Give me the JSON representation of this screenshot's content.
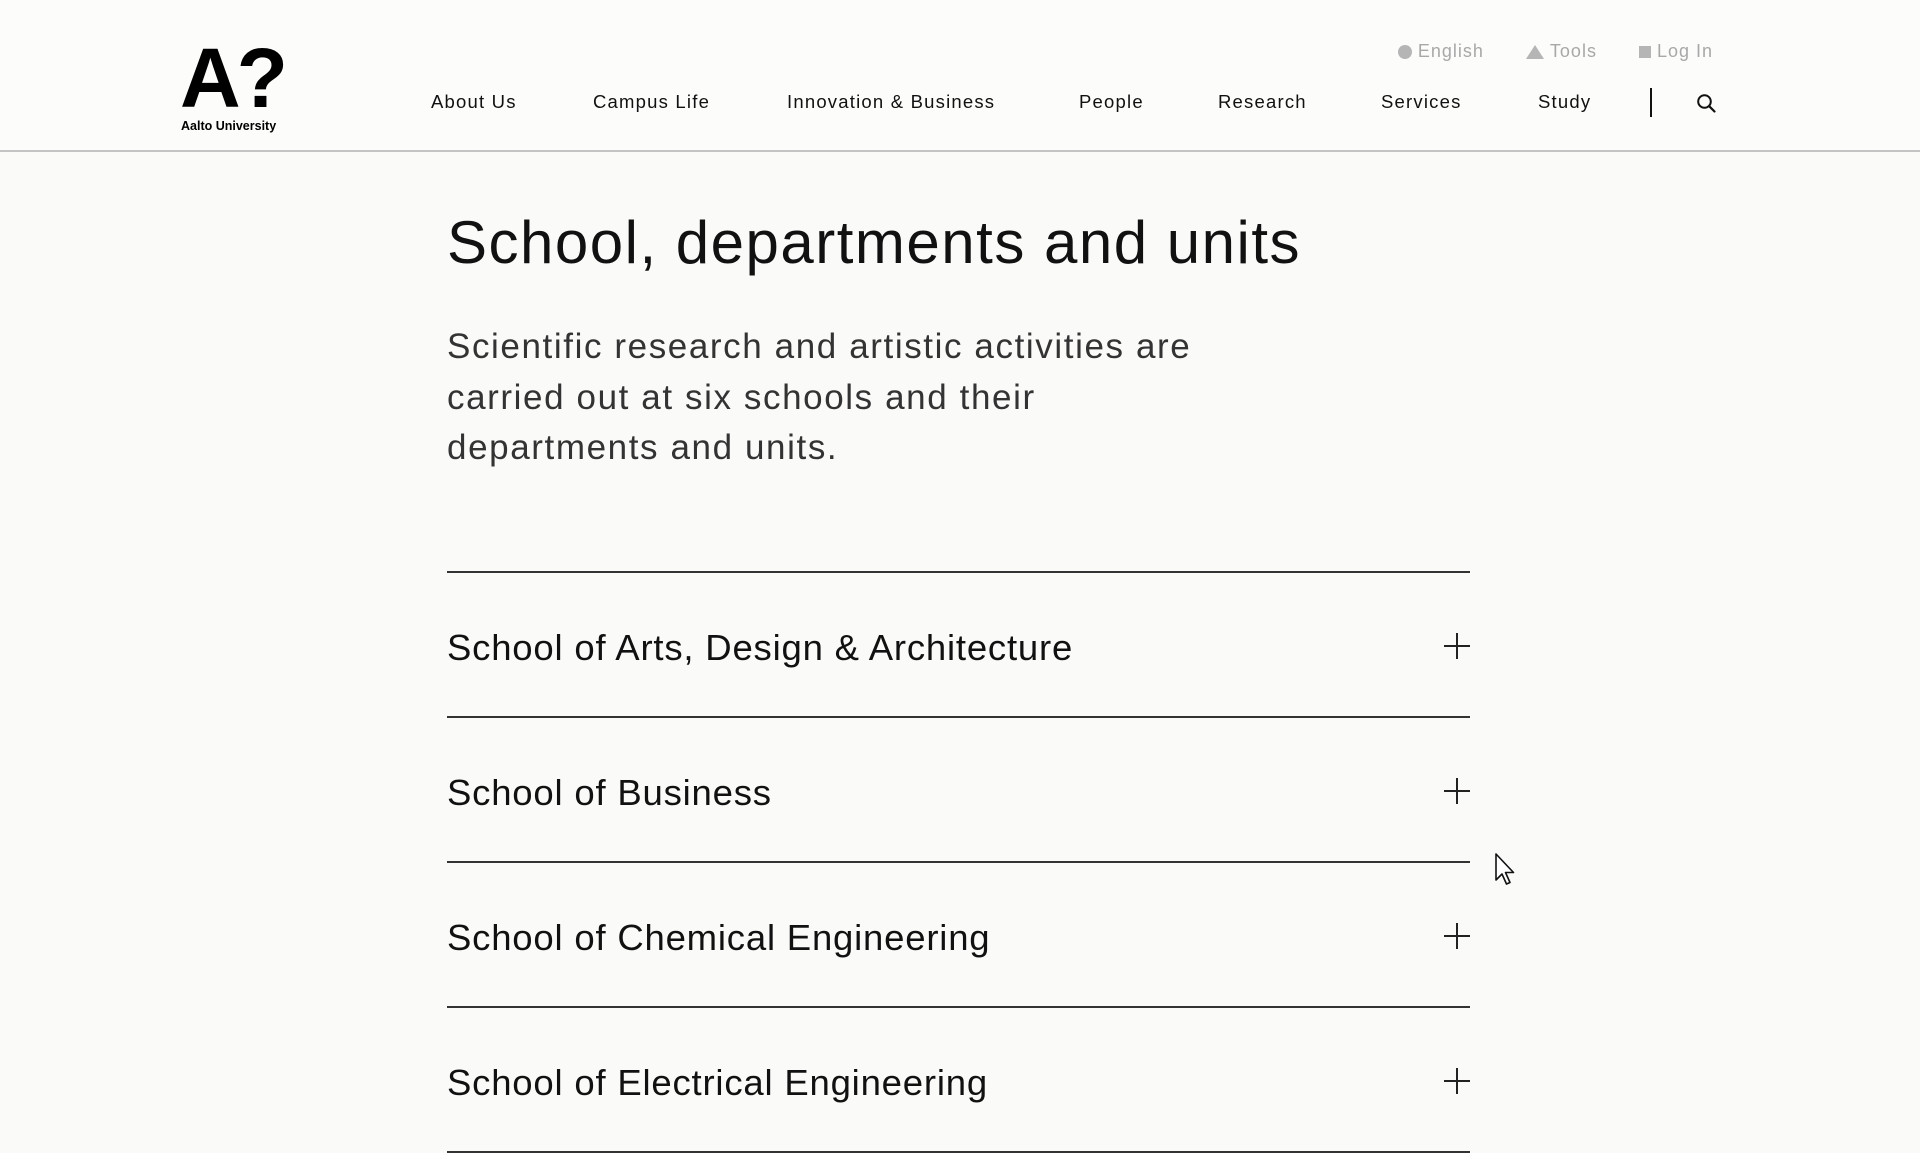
{
  "header": {
    "logo_mark": "A?",
    "logo_text": "Aalto University",
    "utility": {
      "language_label": "English",
      "tools_label": "Tools",
      "login_label": "Log In"
    },
    "nav": [
      {
        "label": "About Us"
      },
      {
        "label": "Campus Life"
      },
      {
        "label": "Innovation & Business"
      },
      {
        "label": "People"
      },
      {
        "label": "Research"
      },
      {
        "label": "Services"
      },
      {
        "label": "Study"
      }
    ],
    "search_icon": "search-icon"
  },
  "main": {
    "title": "School, departments and units",
    "intro": "Scientific research and artistic activities are carried out at six schools and their departments and units.",
    "accordion": [
      {
        "label": "School of Arts, Design & Architecture",
        "expanded": false
      },
      {
        "label": "School of Business",
        "expanded": false
      },
      {
        "label": "School of Chemical Engineering",
        "expanded": false
      },
      {
        "label": "School of Electrical Engineering",
        "expanded": false
      }
    ]
  }
}
